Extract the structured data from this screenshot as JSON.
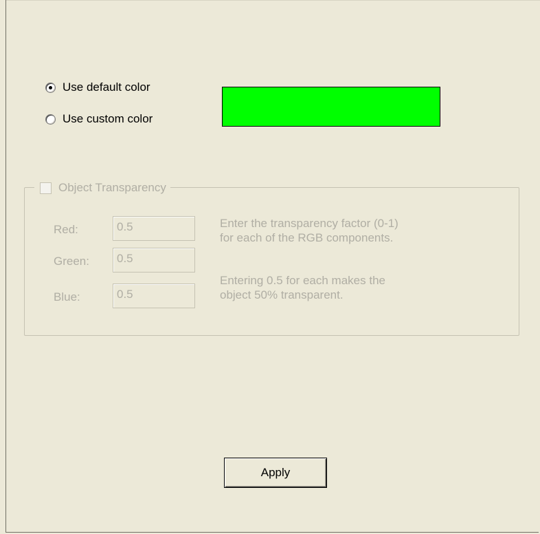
{
  "color_options": {
    "default_label": "Use default color",
    "custom_label": "Use custom color",
    "selected": "default",
    "swatch_color": "#00ff00"
  },
  "transparency": {
    "title": "Object Transparency",
    "enabled": false,
    "red_label": "Red:",
    "red_value": "0.5",
    "green_label": "Green:",
    "green_value": "0.5",
    "blue_label": "Blue:",
    "blue_value": "0.5",
    "hint_line1": "Enter the transparency factor (0-1)",
    "hint_line2": "for each of the RGB components.",
    "hint_line3": "Entering 0.5 for each makes the",
    "hint_line4": "object 50% transparent."
  },
  "actions": {
    "apply_label": "Apply"
  }
}
